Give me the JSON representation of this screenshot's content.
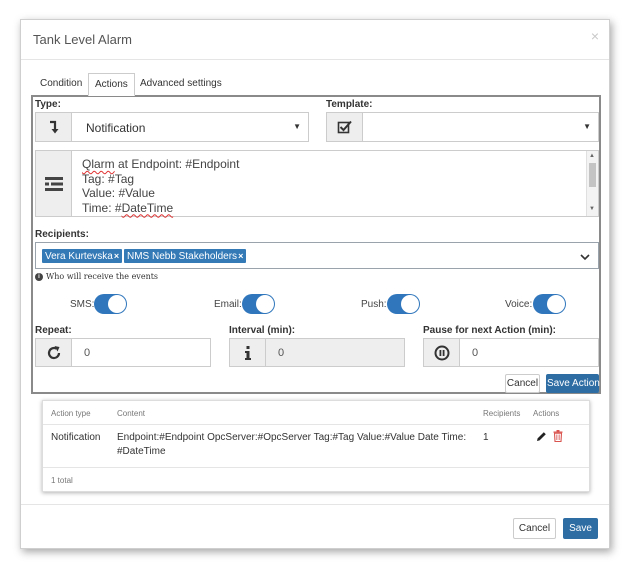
{
  "dialog": {
    "title": "Tank Level Alarm",
    "close_symbol": "×"
  },
  "tabs": [
    {
      "label": "Condition",
      "active": false
    },
    {
      "label": "Actions",
      "active": true
    },
    {
      "label": "Advanced settings",
      "active": false
    }
  ],
  "action_form": {
    "type_label": "Type:",
    "type_value": "Notification",
    "type_icon": "level-down-icon",
    "template_label": "Template:",
    "template_value": "",
    "template_icon": "checkbox-icon",
    "message_icon": "message-lines-icon",
    "message_lines": [
      {
        "misspelled": "Qlarm",
        "rest": " at Endpoint: #Endpoint"
      },
      {
        "misspelled": "",
        "rest": "Tag: #Tag"
      },
      {
        "misspelled": "",
        "rest": "Value: #Value"
      },
      {
        "prefix": "Time: #",
        "misspelled": "DateTime"
      }
    ],
    "recipients_label": "Recipients:",
    "recipients": [
      "Vera Kurtevska",
      "NMS Nebb Stakeholders"
    ],
    "chip_remove_symbol": "×",
    "recipients_hint": "Who will receive the events",
    "channels": [
      {
        "label": "SMS:",
        "on": true
      },
      {
        "label": "Email:",
        "on": true
      },
      {
        "label": "Push:",
        "on": true
      },
      {
        "label": "Voice:",
        "on": true
      }
    ],
    "repeat_label": "Repeat:",
    "repeat_value": "0",
    "repeat_icon": "refresh-icon",
    "interval_label": "Interval (min):",
    "interval_value": "0",
    "interval_icon": "info-icon",
    "pause_label": "Pause for next Action (min):",
    "pause_value": "0",
    "pause_icon": "pause-circle-icon",
    "cancel_label": "Cancel",
    "save_action_label": "Save Action"
  },
  "actions_table": {
    "headers": [
      "Action type",
      "Content",
      "Recipients",
      "Actions"
    ],
    "rows": [
      {
        "type": "Notification",
        "content": "Endpoint:#Endpoint OpcServer:#OpcServer Tag:#Tag Value:#Value Date Time: #DateTime",
        "recipients": "1"
      }
    ],
    "total": "1 total"
  },
  "footer": {
    "cancel_label": "Cancel",
    "save_label": "Save"
  },
  "colors": {
    "primary": "#2e6da4",
    "toggle_on": "#2f76bc",
    "chip": "#337ab7",
    "delete": "#d9534f"
  }
}
